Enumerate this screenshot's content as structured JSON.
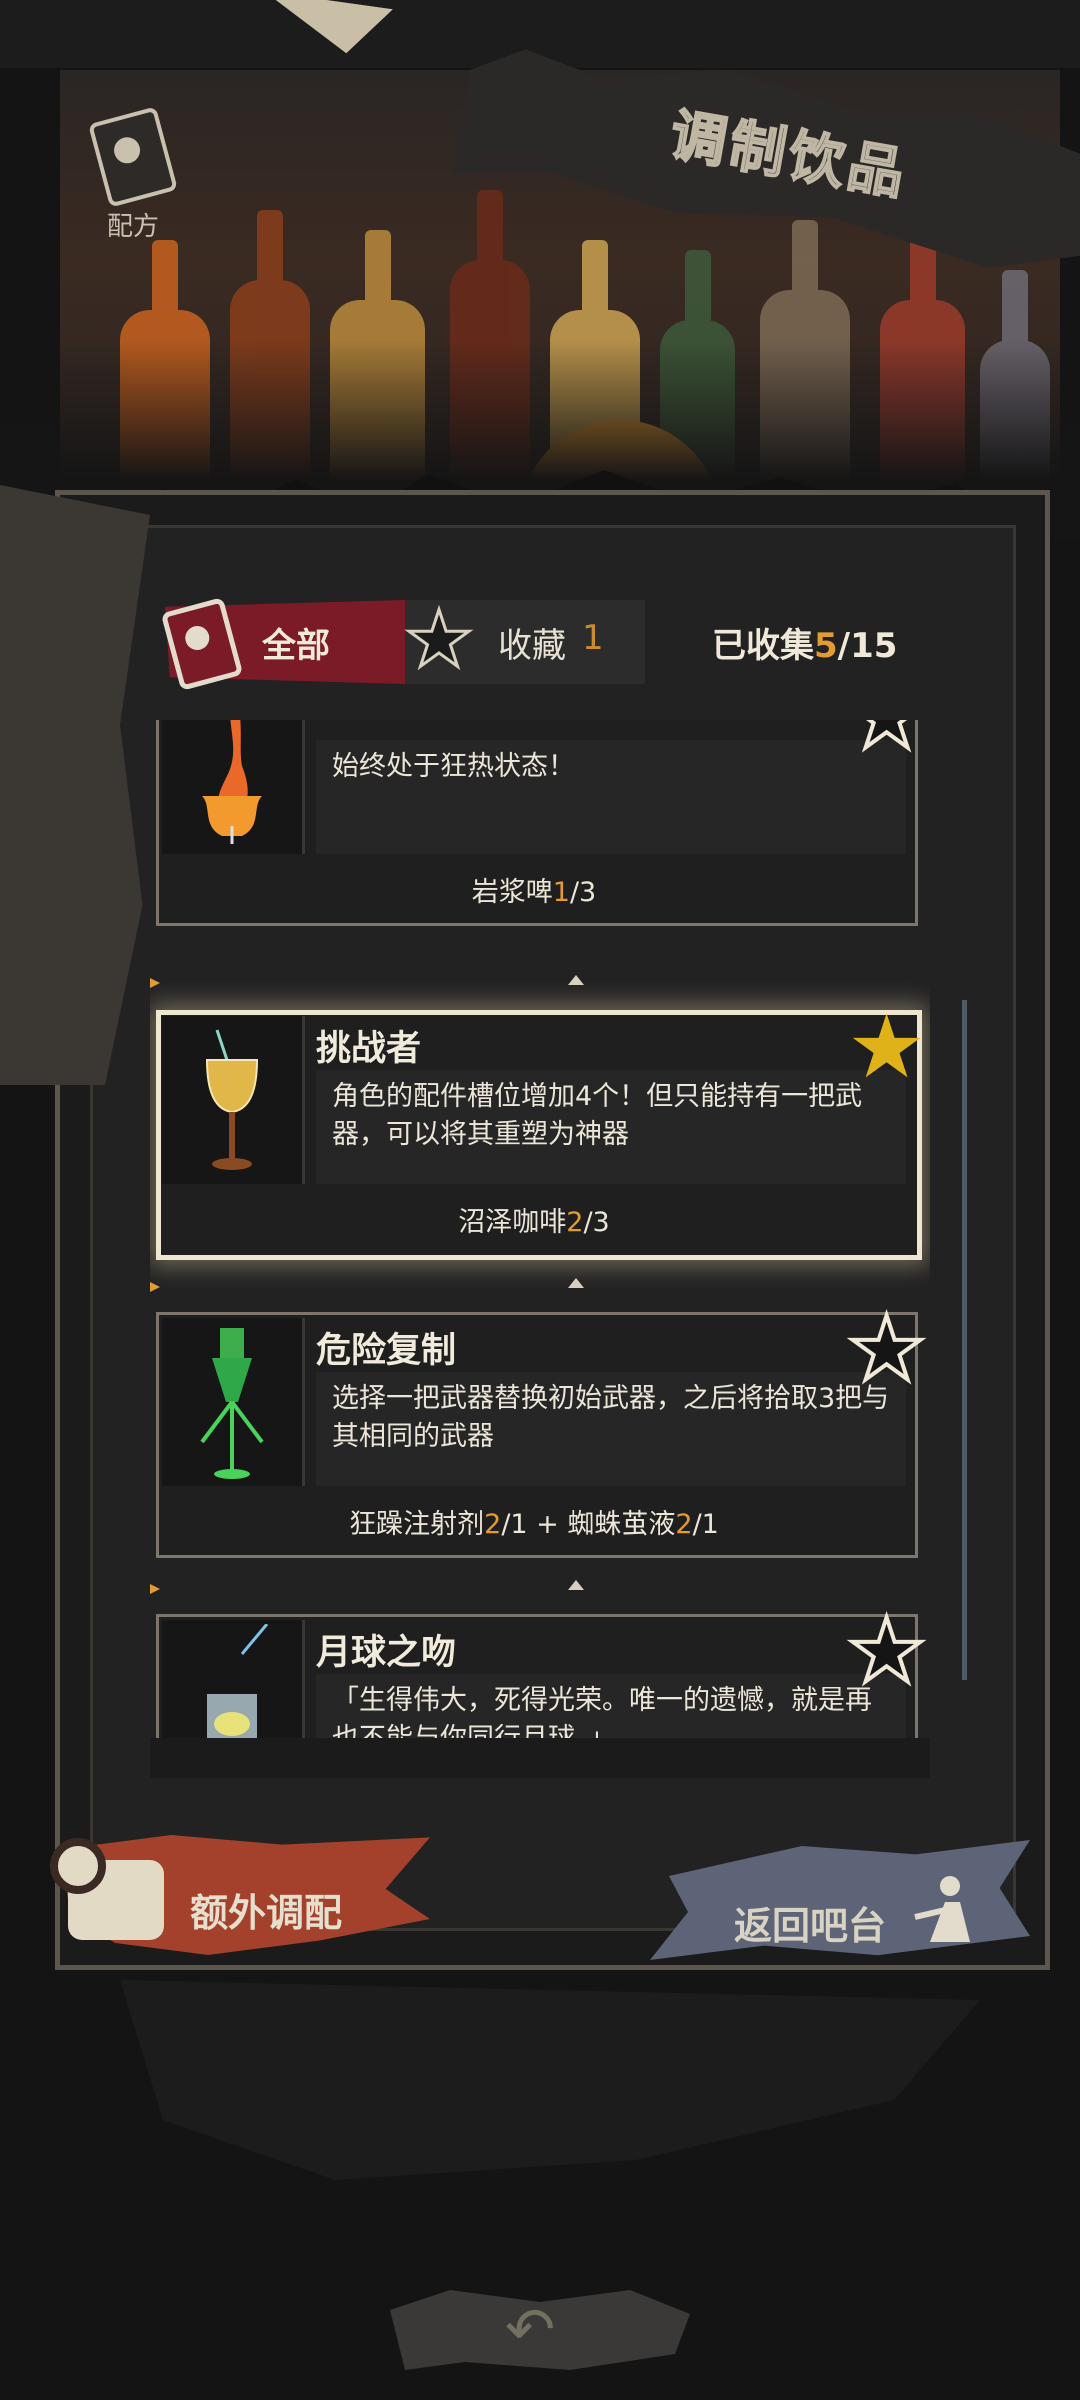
{
  "title": "调制饮品",
  "recipe_button": {
    "label": "配方",
    "icon": "recipe-card-icon"
  },
  "tabs": {
    "all_label": "全部",
    "fav_label": "收藏",
    "fav_count": "1"
  },
  "collected": {
    "label": "已收集",
    "current": "5",
    "sep_total": "/15"
  },
  "cards": [
    {
      "title": "",
      "desc": "始终处于狂热状态！",
      "ingredients": [
        {
          "name": "岩浆啤",
          "have": "1",
          "need": "/3"
        }
      ],
      "favorited": false,
      "drink_icon": "fire-drink-icon"
    },
    {
      "title": "挑战者",
      "desc": "角色的配件槽位增加4个！但只能持有一把武器，可以将其重塑为神器",
      "ingredients": [
        {
          "name": "沼泽咖啡",
          "have": "2",
          "need": "/3"
        }
      ],
      "favorited": true,
      "drink_icon": "golden-goblet-icon"
    },
    {
      "title": "危险复制",
      "desc": "选择一把武器替换初始武器，之后将拾取3把与其相同的武器",
      "ingredients": [
        {
          "name": "狂躁注射剂",
          "have": "2",
          "need": "/1"
        },
        {
          "name": "蜘蛛茧液",
          "have": "2",
          "need": "/1"
        }
      ],
      "plus": " + ",
      "favorited": false,
      "drink_icon": "green-cocktail-icon"
    },
    {
      "title": "月球之吻",
      "desc": "「生得伟大，死得光荣。唯一的遗憾，就是再也不能与你同行月球。」",
      "favorited": false,
      "drink_icon": "lemon-glass-icon"
    }
  ],
  "buttons": {
    "extra": "额外调配",
    "back": "返回吧台"
  },
  "colors": {
    "accent_orange": "#e39b33",
    "tab_active": "#7a1b27",
    "star_gold": "#e0b21a",
    "extra_button": "#a3412d",
    "back_button": "#5e6478"
  }
}
